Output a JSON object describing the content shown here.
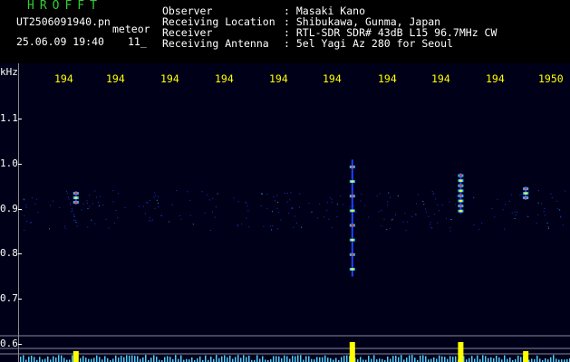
{
  "header": {
    "logo": "HROFFT",
    "filename": "UT2506091940.pn",
    "mode": "meteor",
    "datetime": "25.06.09 19:40",
    "count": "11_",
    "info_labels": [
      "Observer",
      "Receiving Location",
      "Receiver",
      "Receiving Antenna"
    ],
    "info_values": [
      ": Masaki Kano",
      ": Shibukawa, Gunma, Japan",
      ": RTL-SDR SDR# 43dB L15 96.7MHz CW",
      ": 5el Yagi Az 280 for Seoul"
    ]
  },
  "time_axis": {
    "tick_labels": [
      "194",
      "194",
      "194",
      "194",
      "194",
      "194",
      "194",
      "194",
      "194",
      "1950"
    ]
  },
  "freq_axis": {
    "unit": "kHz",
    "labels": [
      "1.1",
      "1.0",
      "0.9",
      "0.8",
      "0.7",
      "0.6"
    ]
  },
  "colors": {
    "background": "#000018",
    "header_bg": "#000000",
    "logo": "#33cc33",
    "header_text": "#ffffff",
    "tick_text": "#ffff00",
    "echo_hot": "#ff3030",
    "echo_warm": "#ffff00",
    "echo_cool": "#30c0ff",
    "echo_faint": "#2040ff",
    "level_bar": "#ffff00",
    "level_noise": "#50d0ff"
  },
  "echoes": [
    {
      "minute": 1940.9,
      "freq_top": 0.94,
      "freq_bottom": 0.91,
      "strength": "medium"
    },
    {
      "minute": 1946.0,
      "freq_top": 1.01,
      "freq_bottom": 0.75,
      "strength": "strong"
    },
    {
      "minute": 1948.0,
      "freq_top": 0.98,
      "freq_bottom": 0.89,
      "strength": "strong"
    },
    {
      "minute": 1949.2,
      "freq_top": 0.95,
      "freq_bottom": 0.92,
      "strength": "medium"
    }
  ]
}
